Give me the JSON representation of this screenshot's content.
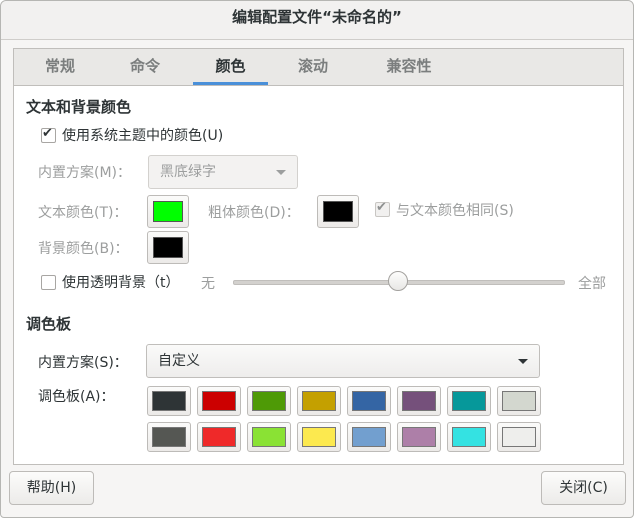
{
  "window": {
    "title": "编辑配置文件“未命名的”"
  },
  "tabs": [
    {
      "label": "常规",
      "active": false
    },
    {
      "label": "命令",
      "active": false
    },
    {
      "label": "颜色",
      "active": true
    },
    {
      "label": "滚动",
      "active": false
    },
    {
      "label": "兼容性",
      "active": false
    }
  ],
  "text_bg": {
    "heading": "文本和背景颜色",
    "use_theme_label": "使用系统主题中的颜色(U)",
    "use_theme_checked": true,
    "builtin_label": "内置方案(M)：",
    "builtin_value": "黑底绿字",
    "text_color_label": "文本颜色(T)：",
    "text_color": "#00ff00",
    "bold_color_label": "粗体颜色(D)：",
    "bold_color": "#000000",
    "same_as_text_label": "与文本颜色相同(S)",
    "same_as_text_checked": true,
    "bg_color_label": "背景颜色(B)：",
    "bg_color": "#000000",
    "transparent_label": "使用透明背景（t）",
    "transparent_checked": false,
    "slider_min_label": "无",
    "slider_max_label": "全部",
    "slider_value": 0.5
  },
  "palette": {
    "heading": "调色板",
    "builtin_label": "内置方案(S)：",
    "builtin_value": "自定义",
    "palette_label": "调色板(A)：",
    "colors": [
      "#2e3436",
      "#cc0000",
      "#4e9a06",
      "#c4a000",
      "#3465a4",
      "#75507b",
      "#06989a",
      "#d3d7cf",
      "#555753",
      "#ef2929",
      "#8ae234",
      "#fce94f",
      "#729fcf",
      "#ad7fa8",
      "#34e2e2",
      "#eeeeec"
    ]
  },
  "footer": {
    "help_label": "帮助(H)",
    "close_label": "关闭(C)"
  },
  "accent_color": "#4a90d9"
}
